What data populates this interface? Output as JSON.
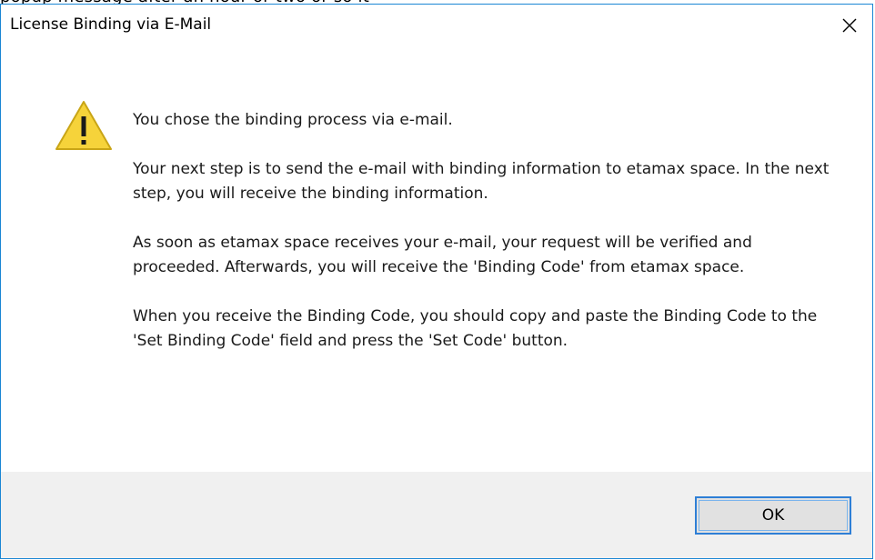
{
  "page_fragment": "popup message after an hour or two or so it",
  "dialog": {
    "title": "License Binding via E-Mail",
    "close_icon": "close-icon",
    "warning_icon": "warning-icon",
    "paragraphs": [
      "You chose the binding process via e-mail.",
      "Your next step is to send the e-mail with binding information to etamax space. In the next step, you will receive the binding information.",
      "As soon as etamax space receives your e-mail, your request will be verified and proceeded. Afterwards, you will receive the 'Binding Code' from etamax space.",
      "When you receive the Binding Code, you should copy and paste the Binding Code to the 'Set Binding Code' field and press the 'Set Code' button."
    ],
    "ok_label": "OK"
  },
  "colors": {
    "window_border": "#1a86d4",
    "footer_background": "#f0f0f0",
    "button_focus_border": "#2e7fd6",
    "warning_yellow": "#f6d33a"
  }
}
